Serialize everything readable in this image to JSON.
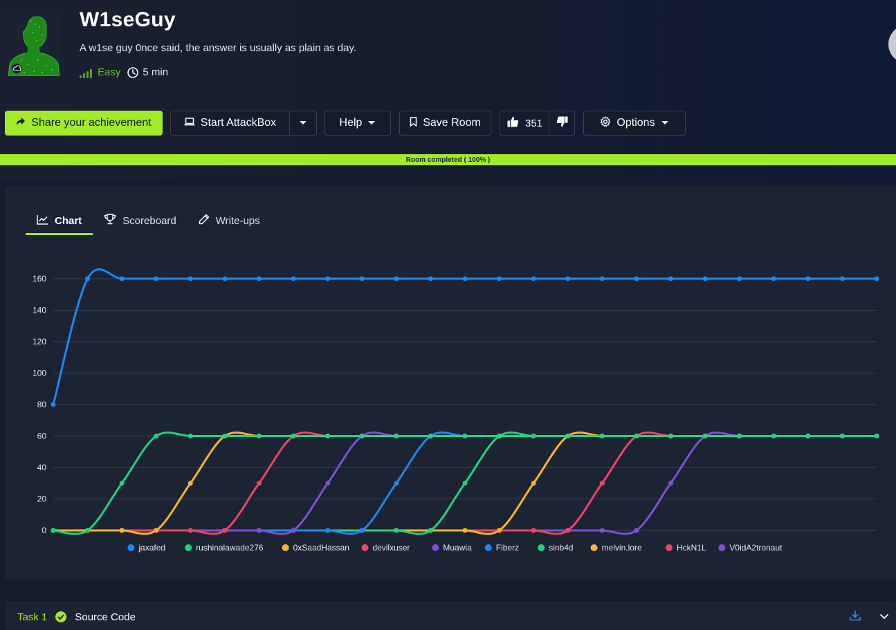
{
  "room": {
    "title": "W1seGuy",
    "description": "A w1se guy 0nce said, the answer is usually as plain as day.",
    "difficulty": "Easy",
    "duration": "5 min",
    "icon": "hacker-silhouette-icon"
  },
  "toolbar": {
    "share_label": "Share your achievement",
    "attackbox_label": "Start AttackBox",
    "help_label": "Help",
    "save_label": "Save Room",
    "upvotes": "351",
    "options_label": "Options"
  },
  "progress": {
    "label": "Room completed ( 100% )",
    "percent": 100
  },
  "tabs": [
    {
      "label": "Chart",
      "icon": "line-chart-icon",
      "active": true
    },
    {
      "label": "Scoreboard",
      "icon": "trophy-icon",
      "active": false
    },
    {
      "label": "Write-ups",
      "icon": "pencil-icon",
      "active": false
    }
  ],
  "task": {
    "number_label": "Task 1",
    "title": "Source Code",
    "completed": true
  },
  "colors": {
    "accent": "#a3ea2a",
    "blue": "#1e88ee",
    "green": "#22d37e",
    "orange": "#f7b52c",
    "red": "#ee4466",
    "purple": "#7b52d2"
  },
  "chart_data": {
    "type": "line",
    "x": [
      0,
      1,
      2,
      3,
      4,
      5,
      6,
      7,
      8,
      9,
      10,
      11,
      12,
      13,
      14,
      15,
      16,
      17,
      18,
      19,
      20,
      21,
      22,
      23,
      24
    ],
    "ylim": [
      0,
      160
    ],
    "yticks": [
      0,
      20,
      40,
      60,
      80,
      100,
      120,
      140,
      160
    ],
    "grid": true,
    "legend_position": "bottom",
    "series": [
      {
        "name": "jaxafed",
        "color": "#1e88ee",
        "values": [
          80,
          160,
          160,
          160,
          160,
          160,
          160,
          160,
          160,
          160,
          160,
          160,
          160,
          160,
          160,
          160,
          160,
          160,
          160,
          160,
          160,
          160,
          160,
          160,
          160
        ]
      },
      {
        "name": "rushinalawade276",
        "color": "#22d37e",
        "values": [
          0,
          0,
          30,
          60,
          60,
          60,
          60,
          60,
          60,
          60,
          60,
          60,
          60,
          60,
          60,
          60,
          60,
          60,
          60,
          60,
          60,
          60,
          60,
          60,
          60
        ]
      },
      {
        "name": "0xSaadHassan",
        "color": "#f7b52c",
        "values": [
          0,
          0,
          0,
          0,
          30,
          60,
          60,
          60,
          60,
          60,
          60,
          60,
          60,
          60,
          60,
          60,
          60,
          60,
          60,
          60,
          60,
          60,
          60,
          60,
          60
        ]
      },
      {
        "name": "devilxuser",
        "color": "#ee4466",
        "values": [
          0,
          0,
          0,
          0,
          0,
          0,
          30,
          60,
          60,
          60,
          60,
          60,
          60,
          60,
          60,
          60,
          60,
          60,
          60,
          60,
          60,
          60,
          60,
          60,
          60
        ]
      },
      {
        "name": "Muawia",
        "color": "#7b52d2",
        "values": [
          0,
          0,
          0,
          0,
          0,
          0,
          0,
          0,
          30,
          60,
          60,
          60,
          60,
          60,
          60,
          60,
          60,
          60,
          60,
          60,
          60,
          60,
          60,
          60,
          60
        ]
      },
      {
        "name": "Fiberz",
        "color": "#1e88ee",
        "values": [
          0,
          0,
          0,
          0,
          0,
          0,
          0,
          0,
          0,
          0,
          30,
          60,
          60,
          60,
          60,
          60,
          60,
          60,
          60,
          60,
          60,
          60,
          60,
          60,
          60
        ]
      },
      {
        "name": "sinb4d",
        "color": "#22d37e",
        "values": [
          0,
          0,
          0,
          0,
          0,
          0,
          0,
          0,
          0,
          0,
          0,
          0,
          30,
          60,
          60,
          60,
          60,
          60,
          60,
          60,
          60,
          60,
          60,
          60,
          60
        ]
      },
      {
        "name": "melvin.lore",
        "color": "#f7b52c",
        "values": [
          0,
          0,
          0,
          0,
          0,
          0,
          0,
          0,
          0,
          0,
          0,
          0,
          0,
          0,
          30,
          60,
          60,
          60,
          60,
          60,
          60,
          60,
          60,
          60,
          60
        ]
      },
      {
        "name": "HckN1L",
        "color": "#ee4466",
        "values": [
          0,
          0,
          0,
          0,
          0,
          0,
          0,
          0,
          0,
          0,
          0,
          0,
          0,
          0,
          0,
          0,
          30,
          60,
          60,
          60,
          60,
          60,
          60,
          60,
          60
        ]
      },
      {
        "name": "V0idA2tronaut",
        "color": "#7b52d2",
        "values": [
          0,
          0,
          0,
          0,
          0,
          0,
          0,
          0,
          0,
          0,
          0,
          0,
          0,
          0,
          0,
          0,
          0,
          0,
          30,
          60,
          60,
          60,
          60,
          60,
          60
        ]
      }
    ]
  }
}
